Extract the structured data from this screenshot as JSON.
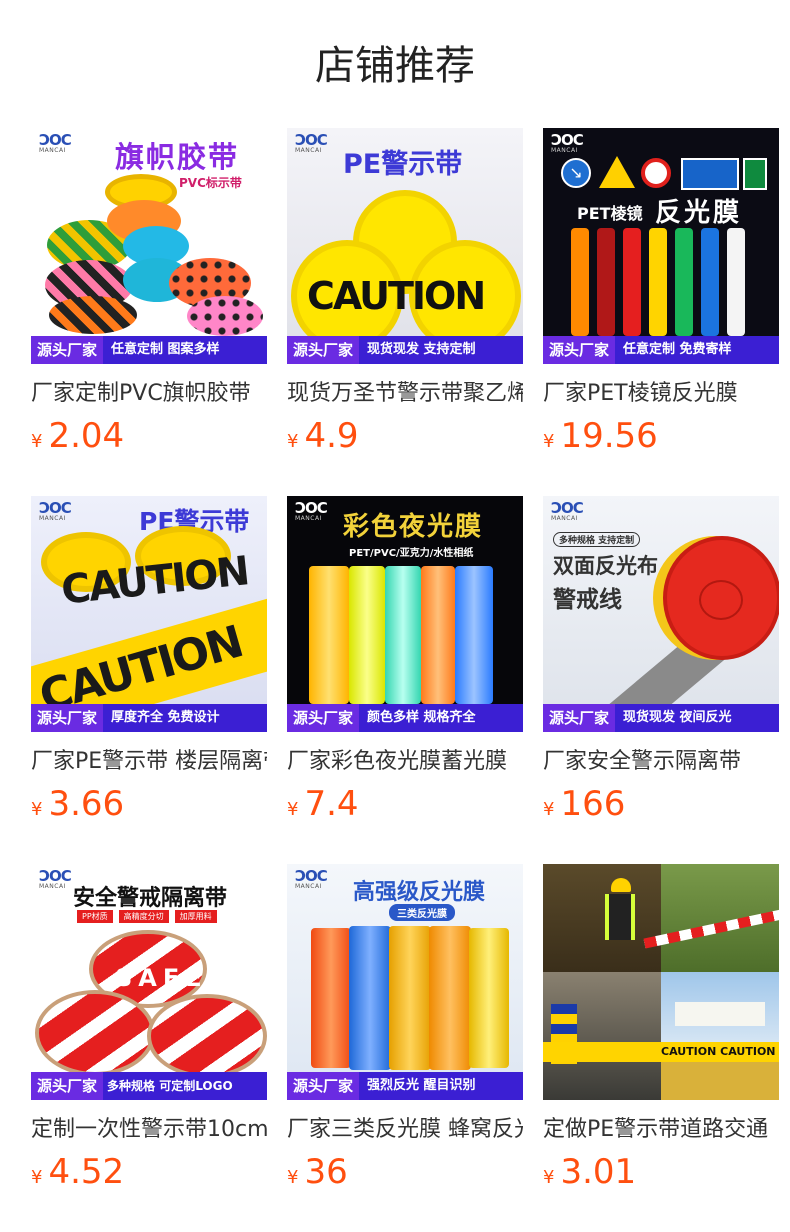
{
  "section": {
    "title": "店铺推荐"
  },
  "currency": "¥",
  "brand": {
    "logo_mark": "ƆOC",
    "logo_text": "MANCAI"
  },
  "products": [
    {
      "name": "厂家定制PVC旗帜胶带",
      "price": "2.04",
      "headline": "旗帜胶带",
      "subline": "PVC标示带",
      "tag1": "源头厂家",
      "tag2": "任意定制  图案多样"
    },
    {
      "name": "现货万圣节警示带聚乙烯",
      "price": "4.9",
      "headline": "PE警示带",
      "subline": "CAUTION",
      "tag1": "源头厂家",
      "tag2": "现货现发  支持定制"
    },
    {
      "name": "厂家PET棱镜反光膜",
      "price": "19.56",
      "headline": "反光膜",
      "subline": "PET棱镜",
      "tag1": "源头厂家",
      "tag2": "任意定制  免费寄样"
    },
    {
      "name": "厂家PE警示带 楼层隔离带",
      "price": "3.66",
      "headline": "PE警示带",
      "subline": "CAUTION",
      "tag1": "源头厂家",
      "tag2": "厚度齐全  免费设计"
    },
    {
      "name": "厂家彩色夜光膜蓄光膜",
      "price": "7.4",
      "headline": "彩色夜光膜",
      "subline": "PET/PVC/亚克力/水性相纸",
      "tag1": "源头厂家",
      "tag2": "颜色多样  规格齐全"
    },
    {
      "name": "厂家安全警示隔离带",
      "price": "166",
      "headline": "双面反光布",
      "subline": "警戒线",
      "badge": "多种规格 支持定制",
      "tag1": "源头厂家",
      "tag2": "现货现发  夜间反光"
    },
    {
      "name": "定制一次性警示带10cm",
      "price": "4.52",
      "headline": "安全警戒隔离带",
      "subline": "SAFE",
      "chips": [
        "PP材质",
        "高精度分切",
        "加厚用料"
      ],
      "tag1": "源头厂家",
      "tag2": "多种规格  可定制LOGO"
    },
    {
      "name": "厂家三类反光膜 蜂窝反光膜",
      "price": "36",
      "headline": "高强级反光膜",
      "subline": "三类反光膜",
      "tag1": "源头厂家",
      "tag2": "强烈反光  醒目识别"
    },
    {
      "name": "定做PE警示带道路交通",
      "price": "3.01",
      "headline": "",
      "subline": "CAUTION  CAUTION  CAUTI"
    }
  ],
  "colors": {
    "price": "#ff4f0f",
    "banner": "#3b1fd3",
    "tag": "#6a2be2"
  }
}
